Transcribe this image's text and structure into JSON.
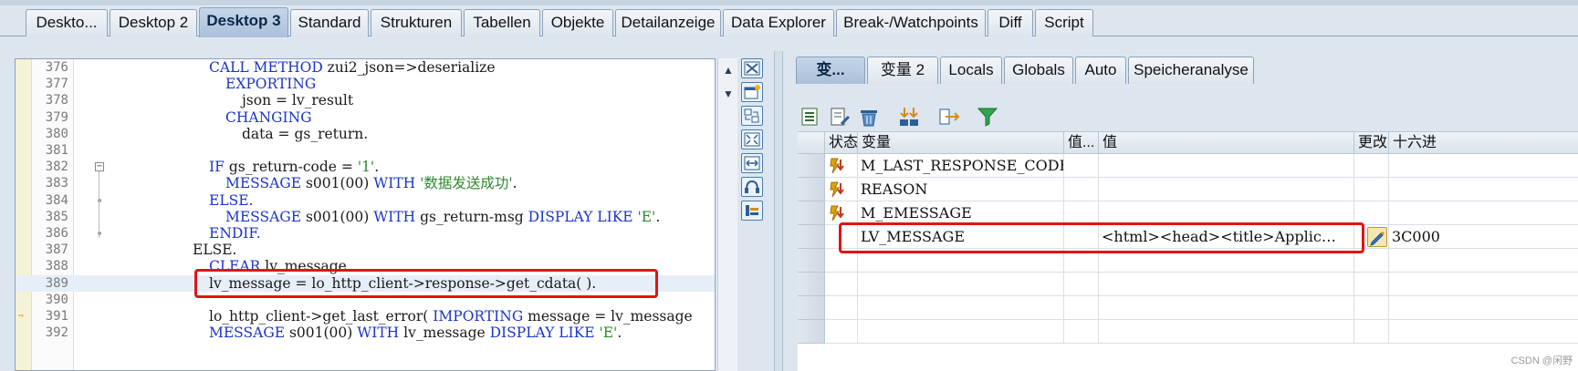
{
  "top_tabs": [
    {
      "label": "Deskto...",
      "active": false
    },
    {
      "label": "Desktop 2",
      "active": false
    },
    {
      "label": "Desktop 3",
      "active": true
    },
    {
      "label": "Standard",
      "active": false
    },
    {
      "label": "Strukturen",
      "active": false
    },
    {
      "label": "Tabellen",
      "active": false
    },
    {
      "label": "Objekte",
      "active": false
    },
    {
      "label": "Detailanzeige",
      "active": false
    },
    {
      "label": "Data Explorer",
      "active": false
    },
    {
      "label": "Break-/Watchpoints",
      "active": false
    },
    {
      "label": "Diff",
      "active": false
    },
    {
      "label": "Script",
      "active": false
    }
  ],
  "code": {
    "lines": [
      {
        "num": "376",
        "indent": 1,
        "parts": [
          {
            "t": "CALL METHOD ",
            "k": "kw"
          },
          {
            "t": "zui2_json=>deserialize"
          }
        ]
      },
      {
        "num": "377",
        "indent": 2,
        "parts": [
          {
            "t": "EXPORTING",
            "k": "kw"
          }
        ]
      },
      {
        "num": "378",
        "indent": 3,
        "parts": [
          {
            "t": "json = lv_result"
          }
        ]
      },
      {
        "num": "379",
        "indent": 2,
        "parts": [
          {
            "t": "CHANGING",
            "k": "kw"
          }
        ]
      },
      {
        "num": "380",
        "indent": 3,
        "parts": [
          {
            "t": "data = gs_return."
          }
        ]
      },
      {
        "num": "381",
        "indent": 0,
        "parts": []
      },
      {
        "num": "382",
        "indent": 1,
        "parts": [
          {
            "t": "IF ",
            "k": "kw"
          },
          {
            "t": "gs_return-code = "
          },
          {
            "t": "'1'",
            "k": "str"
          },
          {
            "t": "."
          }
        ]
      },
      {
        "num": "383",
        "indent": 2,
        "parts": [
          {
            "t": "MESSAGE ",
            "k": "kw"
          },
          {
            "t": "s001(00) "
          },
          {
            "t": "WITH ",
            "k": "kw"
          },
          {
            "t": "'数据发送成功'",
            "k": "str"
          },
          {
            "t": "."
          }
        ]
      },
      {
        "num": "384",
        "indent": 1,
        "parts": [
          {
            "t": "ELSE.",
            "k": "kw"
          }
        ]
      },
      {
        "num": "385",
        "indent": 2,
        "parts": [
          {
            "t": "MESSAGE ",
            "k": "kw"
          },
          {
            "t": "s001(00) "
          },
          {
            "t": "WITH ",
            "k": "kw"
          },
          {
            "t": "gs_return-msg "
          },
          {
            "t": "DISPLAY LIKE ",
            "k": "kw"
          },
          {
            "t": "'E'",
            "k": "str"
          },
          {
            "t": "."
          }
        ]
      },
      {
        "num": "386",
        "indent": 1,
        "parts": [
          {
            "t": "ENDIF.",
            "k": "kw"
          }
        ]
      },
      {
        "num": "387",
        "indent": 0,
        "parts": [
          {
            "t": "ELSE."
          }
        ]
      },
      {
        "num": "388",
        "indent": 1,
        "parts": [
          {
            "t": "CLEAR ",
            "k": "kw"
          },
          {
            "t": "lv_message."
          }
        ]
      },
      {
        "num": "389",
        "indent": 1,
        "parts": [
          {
            "t": "lv_message = lo_http_client->response->get_cdata( )."
          }
        ]
      },
      {
        "num": "390",
        "indent": 0,
        "parts": []
      },
      {
        "num": "391",
        "indent": 1,
        "parts": [
          {
            "t": "lo_http_client->get_last_error( "
          },
          {
            "t": "IMPORTING ",
            "k": "kw"
          },
          {
            "t": "message = lv_message"
          }
        ]
      },
      {
        "num": "392",
        "indent": 1,
        "parts": [
          {
            "t": "MESSAGE ",
            "k": "kw"
          },
          {
            "t": "s001(00) "
          },
          {
            "t": "WITH ",
            "k": "kw"
          },
          {
            "t": "lv_message "
          },
          {
            "t": "DISPLAY LIKE ",
            "k": "kw"
          },
          {
            "t": "'E'",
            "k": "str"
          },
          {
            "t": "."
          }
        ]
      }
    ]
  },
  "var_tabs": [
    {
      "label": "变...",
      "active": true
    },
    {
      "label": "变量 2",
      "active": false
    },
    {
      "label": "Locals",
      "active": false
    },
    {
      "label": "Globals",
      "active": false
    },
    {
      "label": "Auto",
      "active": false
    },
    {
      "label": "Speicheranalyse",
      "active": false
    }
  ],
  "grid": {
    "headers": [
      "状态",
      "变量",
      "值...",
      "值",
      "更改",
      "十六进"
    ],
    "rows": [
      {
        "variable": "M_LAST_RESPONSE_CODE",
        "value": "",
        "hex": "",
        "status_icon": "lightning-arrow-icon"
      },
      {
        "variable": "REASON",
        "value": "",
        "hex": "",
        "status_icon": "lightning-arrow-icon"
      },
      {
        "variable": "M_EMESSAGE",
        "value": "",
        "hex": "",
        "status_icon": "lightning-arrow-icon"
      },
      {
        "variable": "LV_MESSAGE",
        "value": "<html><head><title>Applic…",
        "hex": "3C000",
        "status_icon": ""
      }
    ]
  },
  "watermark": "CSDN @闲野"
}
